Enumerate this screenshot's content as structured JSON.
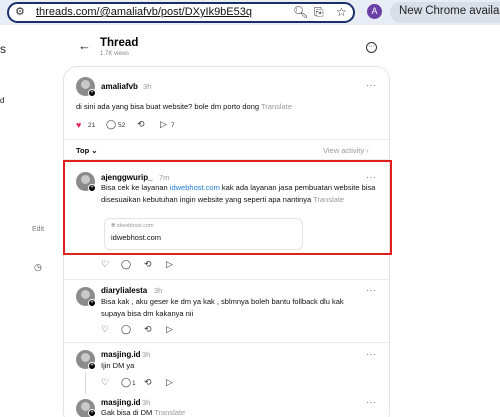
{
  "browser": {
    "url_prefix": "threads.com/@amaliafvb/post/DXyIk9bE53q",
    "update_label": "New Chrome available",
    "profile_initial": "A"
  },
  "sidebar": {
    "top_fragment": "s",
    "mid_fragment": "d",
    "edit_label": "Edit"
  },
  "header": {
    "title": "Thread",
    "views": "1.7K views"
  },
  "post": {
    "username": "amaliafvb",
    "time": "3h",
    "text": "di sini ada yang bisa buat website? bole dm porto dong",
    "translate": "Translate",
    "likes": "21",
    "comments": "52",
    "shares": "7"
  },
  "sort": {
    "label": "Top",
    "view_activity": "View activity"
  },
  "replies": [
    {
      "username": "ajenggwurip_",
      "time": "7m",
      "text_before": "Bisa cek ke layanan ",
      "link": "idwebhost.com",
      "text_after": " kak ada layanan jasa pembuatan website bisa disesuaikan kebutuhan ingin website yang seperti apa nantinya",
      "translate": "Translate",
      "preview_domain": "idwebhost.com",
      "preview_title": "idwebhost.com"
    },
    {
      "username": "diarylialesta",
      "time": "3h",
      "text": "Bisa kak , aku geser ke dm ya kak , sblmnya boleh bantu follback dlu kak supaya bisa dm kakanya nii"
    },
    {
      "username": "masjing.id",
      "time": "3h",
      "text": "Ijin DM ya",
      "comments": "1"
    },
    {
      "username": "masjing.id",
      "time": "3h",
      "text": "Gak bisa di DM",
      "translate": "Translate"
    }
  ],
  "colors": {
    "highlight": "#e0201c",
    "link": "#1d7bd6",
    "like": "#e0245e"
  }
}
